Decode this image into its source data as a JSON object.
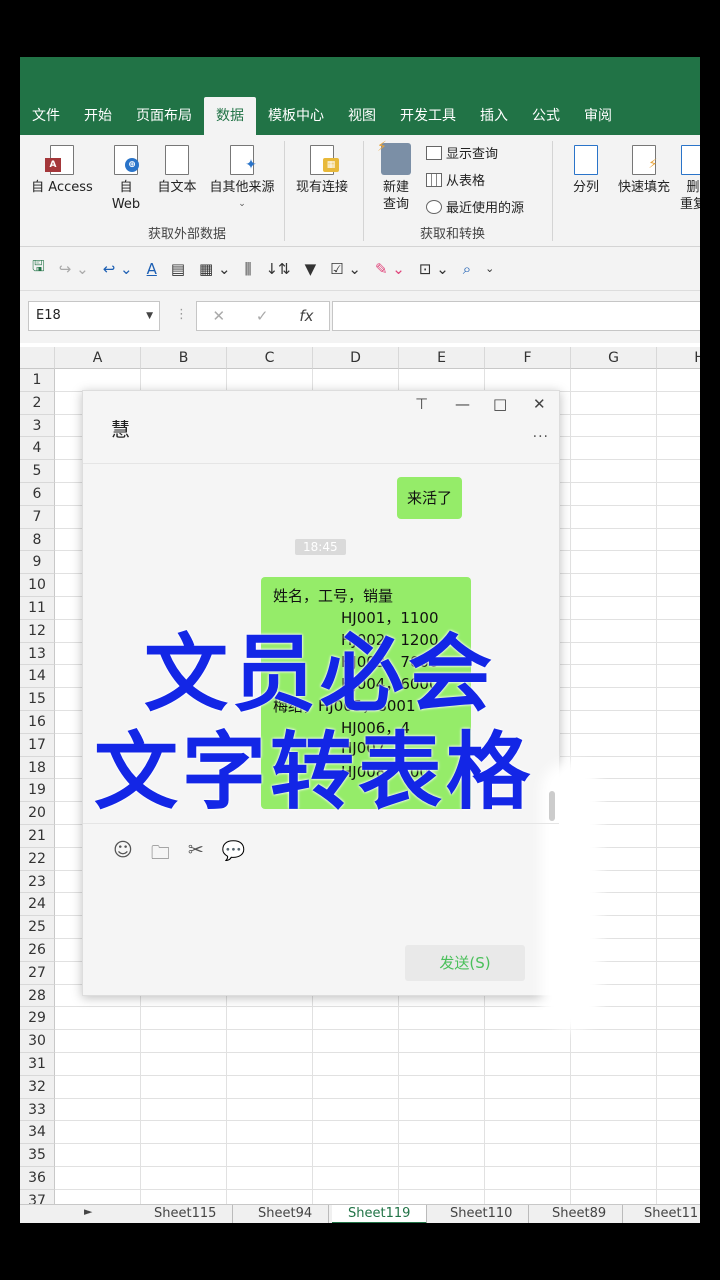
{
  "ribbon": {
    "tabs": [
      "文件",
      "开始",
      "页面布局",
      "数据",
      "模板中心",
      "视图",
      "开发工具",
      "插入",
      "公式",
      "审阅"
    ],
    "active_tab": "数据",
    "get_external": {
      "buttons": [
        {
          "label": "自 Access",
          "icon": "access-db-icon"
        },
        {
          "label": "自\nWeb",
          "icon": "web-doc-icon"
        },
        {
          "label": "自文本",
          "icon": "text-doc-icon"
        },
        {
          "label": "自其他来源",
          "icon": "other-source-icon"
        }
      ],
      "existing_connection": "现有连接",
      "group_label": "获取外部数据"
    },
    "get_transform": {
      "new_query": "新建\n查询",
      "show_queries": "显示查询",
      "from_table": "从表格",
      "recent_sources": "最近使用的源",
      "group_label": "获取和转换"
    },
    "data_tools": {
      "split": "分列",
      "flash_fill": "快速填充",
      "remove_dup": "删\n重复"
    }
  },
  "formula_bar": {
    "name_box": "E18",
    "cancel": "✕",
    "enter": "✓",
    "fx": "fx",
    "value": ""
  },
  "grid": {
    "columns": [
      "A",
      "B",
      "C",
      "D",
      "E",
      "F",
      "G",
      "H"
    ],
    "rows": [
      "1",
      "2",
      "3",
      "4",
      "5",
      "6",
      "7",
      "8",
      "9",
      "10",
      "11",
      "12",
      "13",
      "14",
      "15",
      "16",
      "17",
      "18",
      "19",
      "20",
      "21",
      "22",
      "23",
      "24",
      "25",
      "26",
      "27",
      "28",
      "29",
      "30",
      "31",
      "32",
      "33",
      "34",
      "35",
      "36",
      "37"
    ]
  },
  "sheets": {
    "tabs": [
      "Sheet115",
      "Sheet94",
      "Sheet119",
      "Sheet110",
      "Sheet89",
      "Sheet11"
    ],
    "active": "Sheet119"
  },
  "chat": {
    "title": "慧",
    "message1": "来活了",
    "timestamp": "18:45",
    "table_lines": [
      "姓名，工号，销量",
      "HJ001，1100",
      "HJ002，1200",
      "HJ003，7000",
      "HJ004，6000",
      "梅结，HJ005，8001",
      "HJ006，4",
      "HJ007",
      "HJ008，100"
    ],
    "send_button": "发送(S)",
    "more": "···"
  },
  "overlay": {
    "line1": "文员必会",
    "line2": "文字转表格"
  },
  "colors": {
    "excel_green": "#217346",
    "bubble_green": "#95ec69",
    "overlay_blue": "#1326e6"
  }
}
